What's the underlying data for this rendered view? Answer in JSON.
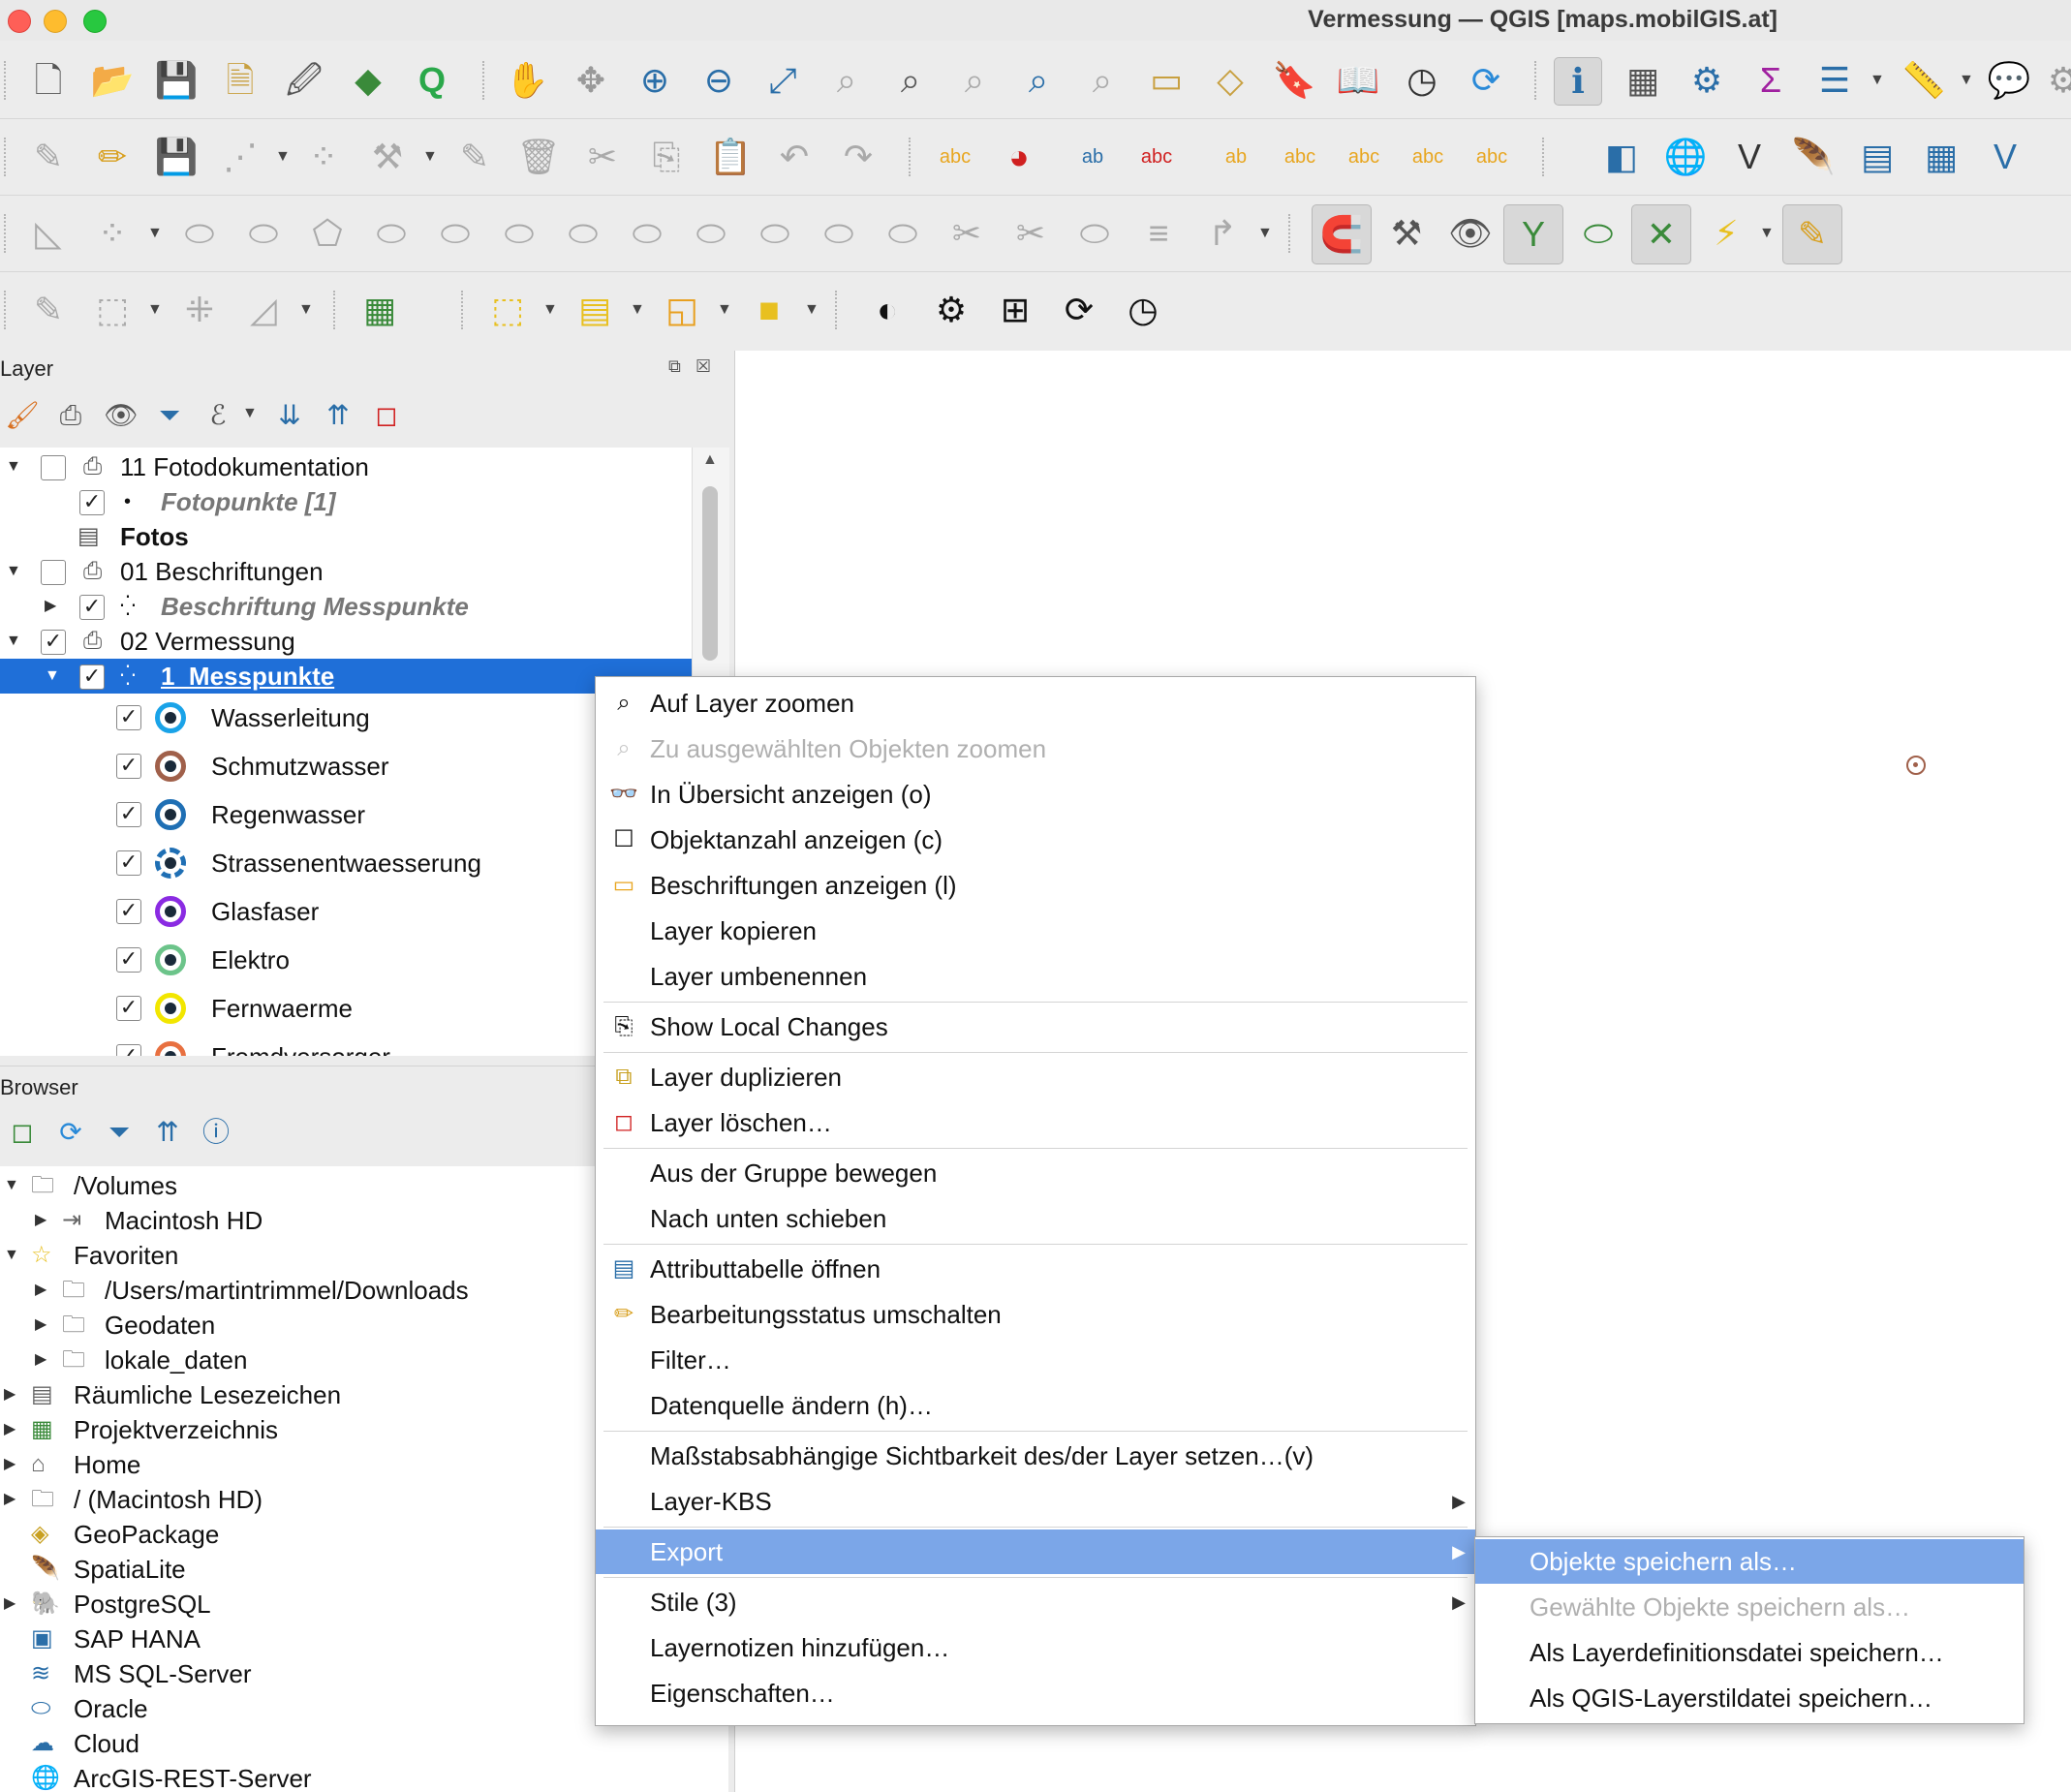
{
  "window": {
    "title": "Vermessung — QGIS [maps.mobilGIS.at]"
  },
  "colors": {
    "accent": "#1f6fd8",
    "menu_highlight": "#7ba6e8"
  },
  "panels": {
    "layers": {
      "title": "Layer"
    },
    "browser": {
      "title": "Browser"
    }
  },
  "layer_tree": {
    "items": [
      {
        "label": "11 Fotodokumentation",
        "checked": false
      },
      {
        "label": "Fotopunkte [1]",
        "checked": true
      },
      {
        "label": "Fotos"
      },
      {
        "label": "01 Beschriftungen",
        "checked": false
      },
      {
        "label": "Beschriftung Messpunkte",
        "checked": true
      },
      {
        "label": "02 Vermessung",
        "checked": true
      },
      {
        "label": "1_Messpunkte",
        "checked": true
      }
    ],
    "legend": [
      {
        "label": "Wasserleitung",
        "color": "#1aa3e8",
        "dot": "#1a2a3a",
        "checked": true
      },
      {
        "label": "Schmutzwasser",
        "color": "#a0604a",
        "dot": "#1a2a3a",
        "checked": true
      },
      {
        "label": "Regenwasser",
        "color": "#1f6fb4",
        "dot": "#1a2a3a",
        "checked": true
      },
      {
        "label": "Strassenentwaesserung",
        "color": "#1f6fb4",
        "dot": "#1a2a3a",
        "checked": true,
        "dashed": true
      },
      {
        "label": "Glasfaser",
        "color": "#8a2be2",
        "dot": "#1a2a3a",
        "checked": true
      },
      {
        "label": "Elektro",
        "color": "#6cc48a",
        "dot": "#1a2a3a",
        "checked": true
      },
      {
        "label": "Fernwaerme",
        "color": "#f2e600",
        "dot": "#1a2a3a",
        "checked": true
      },
      {
        "label": "Fremdversorger",
        "color": "#e87040",
        "dot": "#1a2a3a",
        "checked": true
      }
    ]
  },
  "browser_tree": {
    "items": [
      {
        "label": "/Volumes",
        "icon": "folder-icon"
      },
      {
        "label": "Macintosh HD",
        "icon": "drive-icon"
      },
      {
        "label": "Favoriten",
        "icon": "star-icon"
      },
      {
        "label": "/Users/martintrimmel/Downloads",
        "icon": "folder-icon"
      },
      {
        "label": "Geodaten",
        "icon": "folder-icon"
      },
      {
        "label": "lokale_daten",
        "icon": "folder-icon"
      },
      {
        "label": "Räumliche Lesezeichen",
        "icon": "bookmark-icon"
      },
      {
        "label": "Projektverzeichnis",
        "icon": "project-icon"
      },
      {
        "label": "Home",
        "icon": "home-icon"
      },
      {
        "label": "/ (Macintosh HD)",
        "icon": "folder-icon"
      },
      {
        "label": "GeoPackage",
        "icon": "geopackage-icon"
      },
      {
        "label": "SpatiaLite",
        "icon": "spatialite-icon"
      },
      {
        "label": "PostgreSQL",
        "icon": "postgresql-icon"
      },
      {
        "label": "SAP HANA",
        "icon": "saphana-icon"
      },
      {
        "label": "MS SQL-Server",
        "icon": "mssql-icon"
      },
      {
        "label": "Oracle",
        "icon": "oracle-icon"
      },
      {
        "label": "Cloud",
        "icon": "cloud-icon"
      },
      {
        "label": "ArcGIS-REST-Server",
        "icon": "arcgis-icon"
      }
    ]
  },
  "context_menu": {
    "items": [
      {
        "label": "Auf Layer zoomen",
        "icon": "zoom-layer-icon",
        "enabled": true
      },
      {
        "label": "Zu ausgewählten Objekten zoomen",
        "icon": "zoom-selected-icon",
        "enabled": false
      },
      {
        "label": "In Übersicht anzeigen (o)",
        "icon": "overview-icon",
        "enabled": true
      },
      {
        "label": "Objektanzahl anzeigen (c)",
        "icon": "checkbox-icon",
        "enabled": true
      },
      {
        "label": "Beschriftungen anzeigen (l)",
        "icon": "labels-icon",
        "enabled": true
      },
      {
        "label": "Layer kopieren",
        "enabled": true
      },
      {
        "label": "Layer umbenennen",
        "enabled": true
      },
      {
        "label": "Show Local Changes",
        "icon": "local-changes-icon",
        "enabled": true
      },
      {
        "label": "Layer duplizieren",
        "icon": "duplicate-icon",
        "enabled": true
      },
      {
        "label": "Layer löschen…",
        "icon": "remove-layer-icon",
        "enabled": true
      },
      {
        "label": "Aus der Gruppe bewegen",
        "enabled": true
      },
      {
        "label": "Nach unten schieben",
        "enabled": true
      },
      {
        "label": "Attributtabelle öffnen",
        "icon": "attribute-table-icon",
        "enabled": true
      },
      {
        "label": "Bearbeitungsstatus umschalten",
        "icon": "pencil-icon",
        "enabled": true
      },
      {
        "label": "Filter…",
        "enabled": true
      },
      {
        "label": "Datenquelle ändern (h)…",
        "enabled": true
      },
      {
        "label": "Maßstabsabhängige Sichtbarkeit des/der Layer setzen…(v)",
        "enabled": true
      },
      {
        "label": "Layer-KBS",
        "enabled": true,
        "submenu": true
      },
      {
        "label": "Export",
        "enabled": true,
        "submenu": true,
        "active": true
      },
      {
        "label": "Stile (3)",
        "enabled": true,
        "submenu": true
      },
      {
        "label": "Layernotizen hinzufügen…",
        "enabled": true
      },
      {
        "label": "Eigenschaften…",
        "enabled": true
      }
    ]
  },
  "export_submenu": {
    "items": [
      {
        "label": "Objekte speichern als…",
        "enabled": true,
        "active": true
      },
      {
        "label": "Gewählte Objekte speichern als…",
        "enabled": false
      },
      {
        "label": "Als Layerdefinitionsdatei speichern…",
        "enabled": true
      },
      {
        "label": "Als QGIS-Layerstildatei speichern…",
        "enabled": true
      }
    ]
  },
  "submenu_arrow": "▶"
}
